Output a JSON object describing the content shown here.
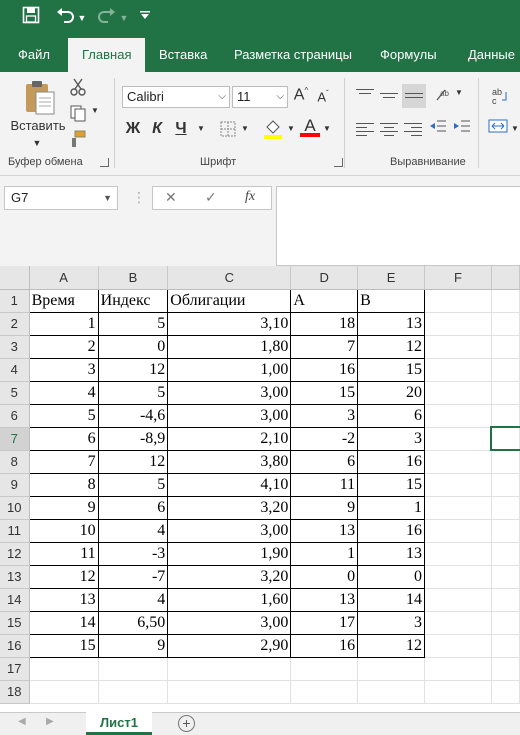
{
  "ribbon": {
    "tabs": [
      "Файл",
      "Главная",
      "Вставка",
      "Разметка страницы",
      "Формулы",
      "Данные"
    ],
    "paste_label": "Вставить",
    "font_name": "Calibri",
    "font_size": "11",
    "bold": "Ж",
    "italic": "К",
    "underline": "Ч",
    "grow_font": "A",
    "shrink_font": "A",
    "font_color_glyph": "A",
    "groups": {
      "clipboard": "Буфер обмена",
      "font": "Шрифт",
      "alignment": "Выравнивание"
    },
    "accent_color": "#217346"
  },
  "formula_bar": {
    "name_box": "G7",
    "fx": "fx",
    "value": ""
  },
  "sheet": {
    "columns": [
      "A",
      "B",
      "C",
      "D",
      "E",
      "F"
    ],
    "row_numbers": [
      "1",
      "2",
      "3",
      "4",
      "5",
      "6",
      "7",
      "8",
      "9",
      "10",
      "11",
      "12",
      "13",
      "14",
      "15",
      "16",
      "17",
      "18"
    ],
    "header_row": [
      "Время",
      "Индекс",
      "Облигации",
      "A",
      "B"
    ],
    "rows": [
      [
        "1",
        "5",
        "3,10",
        "18",
        "13"
      ],
      [
        "2",
        "0",
        "1,80",
        "7",
        "12"
      ],
      [
        "3",
        "12",
        "1,00",
        "16",
        "15"
      ],
      [
        "4",
        "5",
        "3,00",
        "15",
        "20"
      ],
      [
        "5",
        "-4,6",
        "3,00",
        "3",
        "6"
      ],
      [
        "6",
        "-8,9",
        "2,10",
        "-2",
        "3"
      ],
      [
        "7",
        "12",
        "3,80",
        "6",
        "16"
      ],
      [
        "8",
        "5",
        "4,10",
        "11",
        "15"
      ],
      [
        "9",
        "6",
        "3,20",
        "9",
        "1"
      ],
      [
        "10",
        "4",
        "3,00",
        "13",
        "16"
      ],
      [
        "11",
        "-3",
        "1,90",
        "1",
        "13"
      ],
      [
        "12",
        "-7",
        "3,20",
        "0",
        "0"
      ],
      [
        "13",
        "4",
        "1,60",
        "13",
        "14"
      ],
      [
        "14",
        "6,50",
        "3,00",
        "17",
        "3"
      ],
      [
        "15",
        "9",
        "2,90",
        "16",
        "12"
      ]
    ],
    "selected_cell": "G7",
    "active_sheet": "Лист1"
  }
}
